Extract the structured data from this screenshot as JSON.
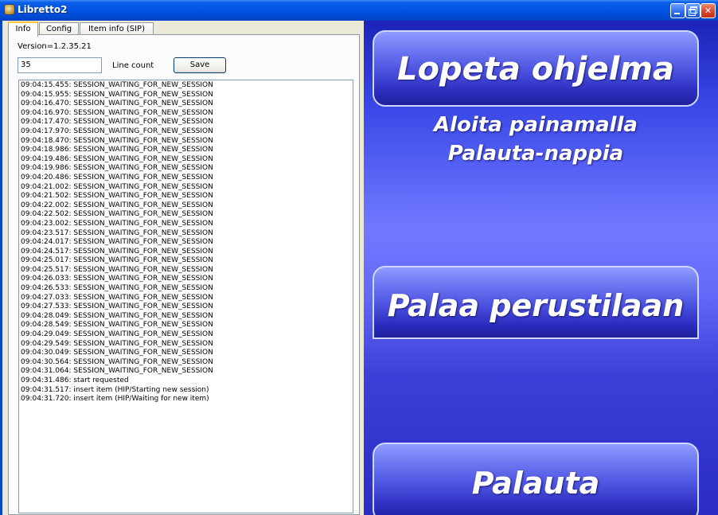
{
  "window": {
    "title": "Libretto2"
  },
  "tabs": [
    {
      "label": "Info"
    },
    {
      "label": "Config"
    },
    {
      "label": "Item info (SIP)"
    }
  ],
  "info": {
    "version": "Version=1.2.35.21",
    "line_count_value": "35",
    "line_count_label": "Line count",
    "save_label": "Save"
  },
  "log": [
    "09:04:15.455: SESSION_WAITING_FOR_NEW_SESSION",
    "09:04:15.955: SESSION_WAITING_FOR_NEW_SESSION",
    "09:04:16.470: SESSION_WAITING_FOR_NEW_SESSION",
    "09:04:16.970: SESSION_WAITING_FOR_NEW_SESSION",
    "09:04:17.470: SESSION_WAITING_FOR_NEW_SESSION",
    "09:04:17.970: SESSION_WAITING_FOR_NEW_SESSION",
    "09:04:18.470: SESSION_WAITING_FOR_NEW_SESSION",
    "09:04:18.986: SESSION_WAITING_FOR_NEW_SESSION",
    "09:04:19.486: SESSION_WAITING_FOR_NEW_SESSION",
    "09:04:19.986: SESSION_WAITING_FOR_NEW_SESSION",
    "09:04:20.486: SESSION_WAITING_FOR_NEW_SESSION",
    "09:04:21.002: SESSION_WAITING_FOR_NEW_SESSION",
    "09:04:21.502: SESSION_WAITING_FOR_NEW_SESSION",
    "09:04:22.002: SESSION_WAITING_FOR_NEW_SESSION",
    "09:04:22.502: SESSION_WAITING_FOR_NEW_SESSION",
    "09:04:23.002: SESSION_WAITING_FOR_NEW_SESSION",
    "09:04:23.517: SESSION_WAITING_FOR_NEW_SESSION",
    "09:04:24.017: SESSION_WAITING_FOR_NEW_SESSION",
    "09:04:24.517: SESSION_WAITING_FOR_NEW_SESSION",
    "09:04:25.017: SESSION_WAITING_FOR_NEW_SESSION",
    "09:04:25.517: SESSION_WAITING_FOR_NEW_SESSION",
    "09:04:26.033: SESSION_WAITING_FOR_NEW_SESSION",
    "09:04:26.533: SESSION_WAITING_FOR_NEW_SESSION",
    "09:04:27.033: SESSION_WAITING_FOR_NEW_SESSION",
    "09:04:27.533: SESSION_WAITING_FOR_NEW_SESSION",
    "09:04:28.049: SESSION_WAITING_FOR_NEW_SESSION",
    "09:04:28.549: SESSION_WAITING_FOR_NEW_SESSION",
    "09:04:29.049: SESSION_WAITING_FOR_NEW_SESSION",
    "09:04:29.549: SESSION_WAITING_FOR_NEW_SESSION",
    "09:04:30.049: SESSION_WAITING_FOR_NEW_SESSION",
    "09:04:30.564: SESSION_WAITING_FOR_NEW_SESSION",
    "09:04:31.064: SESSION_WAITING_FOR_NEW_SESSION",
    "09:04:31.486: start requested",
    "09:04:31.517: insert item (HIP/Starting new session)",
    "09:04:31.720: insert item (HIP/Waiting for new item)"
  ],
  "actions": {
    "quit_label": "Lopeta ohjelma",
    "instruction_line1": "Aloita painamalla",
    "instruction_line2": "Palauta-nappia",
    "home_label": "Palaa perustilaan",
    "return_label": "Palauta"
  },
  "icons": {
    "app": "app-icon",
    "minimize": "minimize-icon",
    "maximize": "restore-icon",
    "close": "close-icon"
  },
  "colors": {
    "titlebar": "#0053e1",
    "panel_bg": "#ece9d8",
    "action_bg": "#4a50de",
    "close_button": "#d8452a"
  }
}
